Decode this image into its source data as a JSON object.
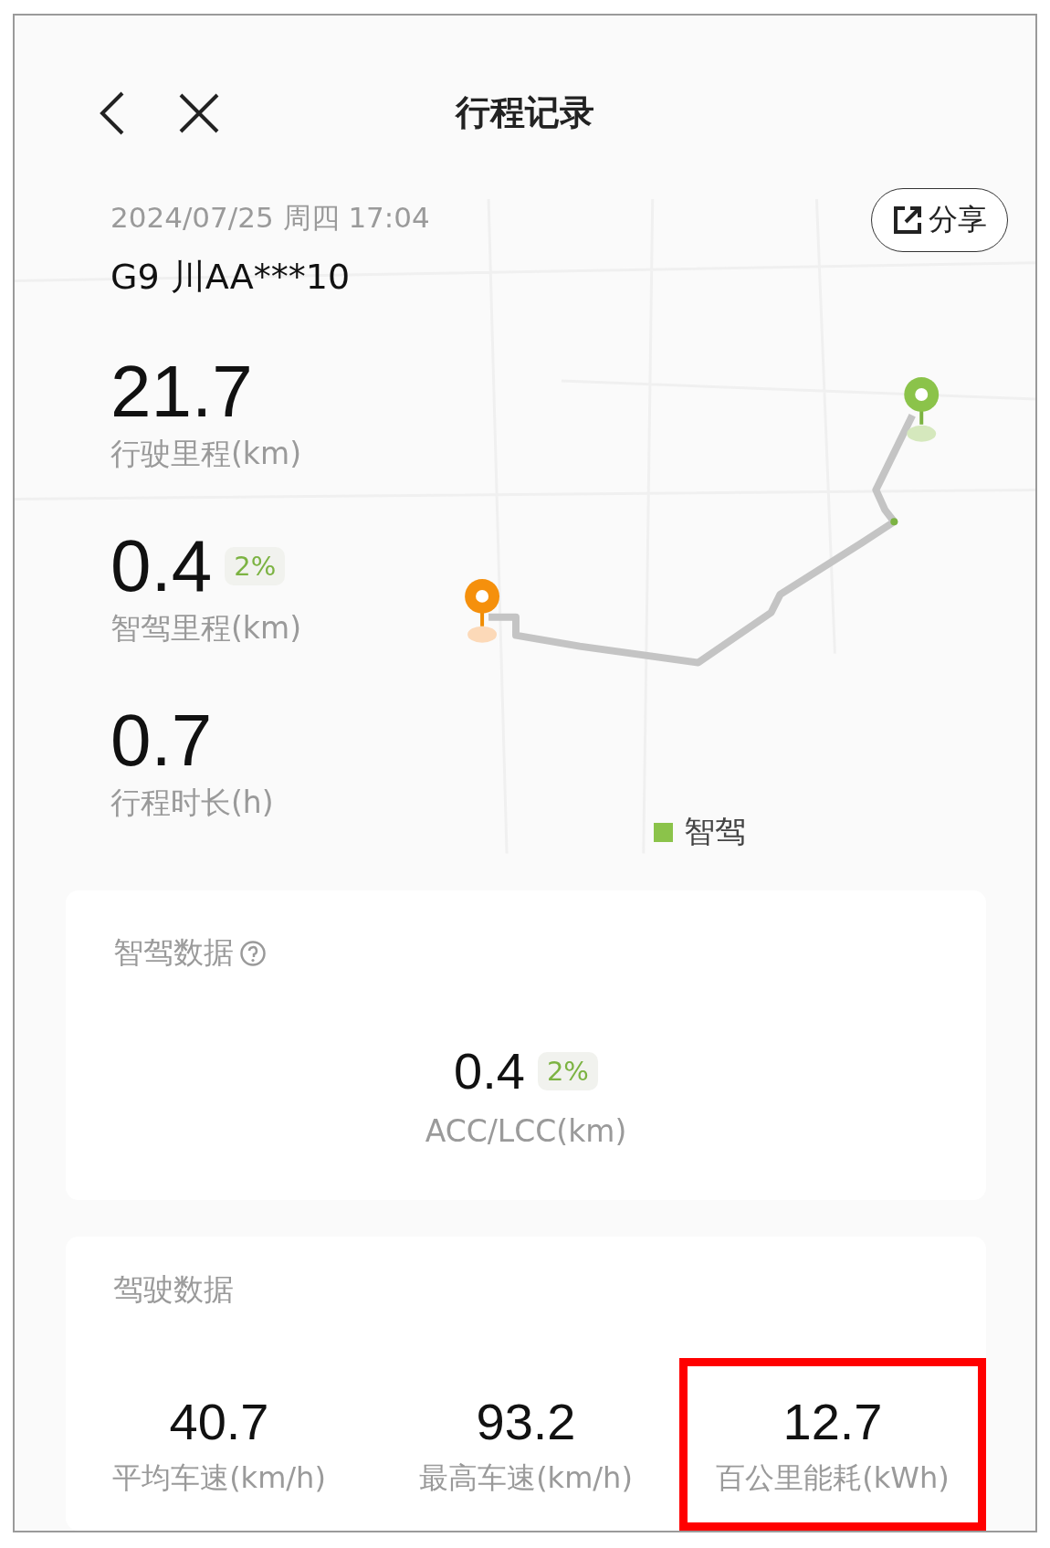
{
  "header": {
    "title": "行程记录"
  },
  "trip": {
    "datetime": "2024/07/25 周四 17:04",
    "vehicle": "G9 川AA***10",
    "share_label": "分享"
  },
  "stats": [
    {
      "value": "21.7",
      "label": "行驶里程(km)"
    },
    {
      "value": "0.4",
      "badge": "2%",
      "label": "智驾里程(km)"
    },
    {
      "value": "0.7",
      "label": "行程时长(h)"
    }
  ],
  "legend": {
    "label": "智驾",
    "color": "#8bc34a"
  },
  "assisted_driving": {
    "title": "智驾数据",
    "value": "0.4",
    "badge": "2%",
    "label": "ACC/LCC(km)"
  },
  "driving_data": {
    "title": "驾驶数据",
    "items": [
      {
        "value": "40.7",
        "label": "平均车速(km/h)",
        "highlighted": false
      },
      {
        "value": "93.2",
        "label": "最高车速(km/h)",
        "highlighted": false
      },
      {
        "value": "12.7",
        "label": "百公里能耗(kWh)",
        "highlighted": true
      }
    ]
  }
}
